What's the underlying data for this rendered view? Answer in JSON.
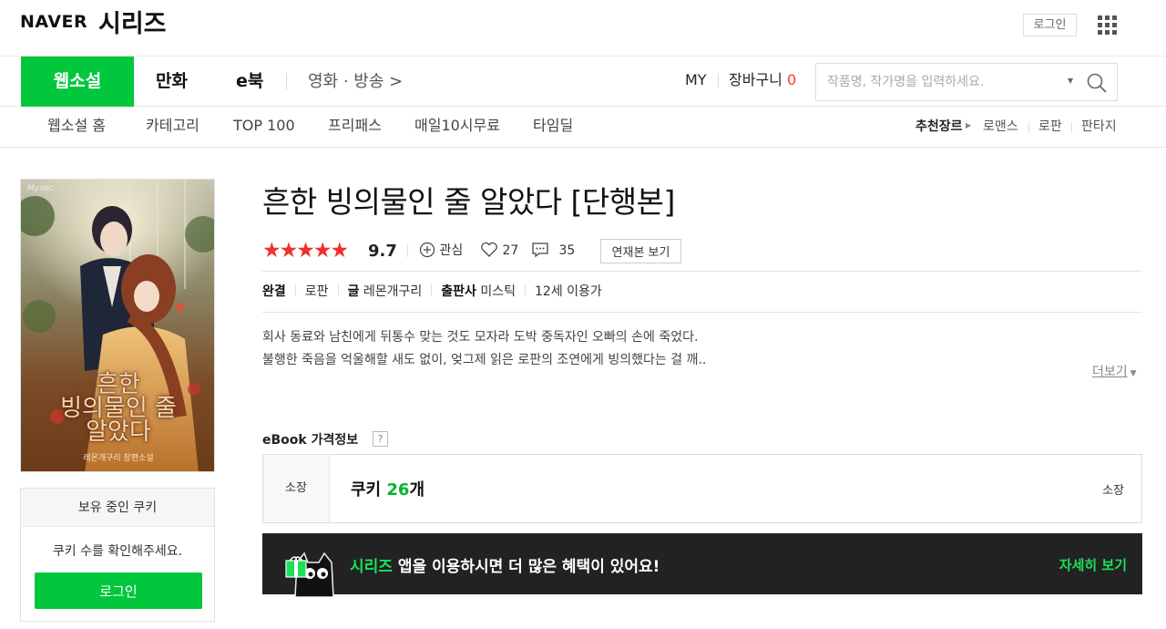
{
  "header": {
    "brand_naver": "NAVER",
    "brand_series": "시리즈",
    "login_label": "로그인",
    "apps_icon": "grid-apps-icon"
  },
  "nav": {
    "tabs": [
      {
        "label": "웹소설",
        "active": true
      },
      {
        "label": "만화",
        "active": false
      },
      {
        "label": "e북",
        "active": false
      }
    ],
    "more_label": "영화 · 방송 >",
    "my_label": "MY",
    "cart_label": "장바구니",
    "cart_count": "0",
    "search_placeholder": "작품명, 작가명을 입력하세요.",
    "accent_color": "#00c73c"
  },
  "subnav": {
    "items": [
      "웹소설 홈",
      "카테고리",
      "TOP 100",
      "프리패스",
      "매일10시무료",
      "타임딜"
    ],
    "genre_label": "추천장르",
    "genres": [
      "로맨스",
      "로판",
      "판타지"
    ]
  },
  "book": {
    "title": "흔한 빙의물인 줄 알았다 [단행본]",
    "stars": "★★★★★",
    "rating": "9.7",
    "interest_label": "관심",
    "likes": "27",
    "comments": "35",
    "serial_button": "연재본 보기",
    "status": "완결",
    "genre": "로판",
    "author_label": "글",
    "author": "레몬개구리",
    "publisher_label": "출판사",
    "publisher": "미스틱",
    "age": "12세 이용가",
    "synopsis_line1": "회사 동료와 남친에게 뒤통수 맞는 것도 모자라 도박 중독자인 오빠의 손에 죽었다.",
    "synopsis_line2": "불행한 죽음을 억울해할 새도 없이, 엊그제 읽은 로판의 조연에게 빙의했다는 걸 깨..",
    "more_label": "더보기",
    "cover": {
      "badge": "Mystic",
      "title_line1": "흔한",
      "title_line2": "빙의물인 줄",
      "title_line3": "알았다",
      "author": "레몬개구리 장편소설"
    }
  },
  "cookie": {
    "header": "보유 중인 쿠키",
    "message": "쿠키 수를 확인해주세요.",
    "login_button": "로그인"
  },
  "price": {
    "section_title": "eBook 가격정보",
    "help": "?",
    "label": "소장",
    "prefix": "쿠키",
    "count": "26",
    "suffix": "개",
    "right_label": "소장"
  },
  "banner": {
    "brand": "시리즈",
    "text": " 앱을 이용하시면 더 많은 혜택이 있어요!",
    "link": "자세히 보기"
  }
}
